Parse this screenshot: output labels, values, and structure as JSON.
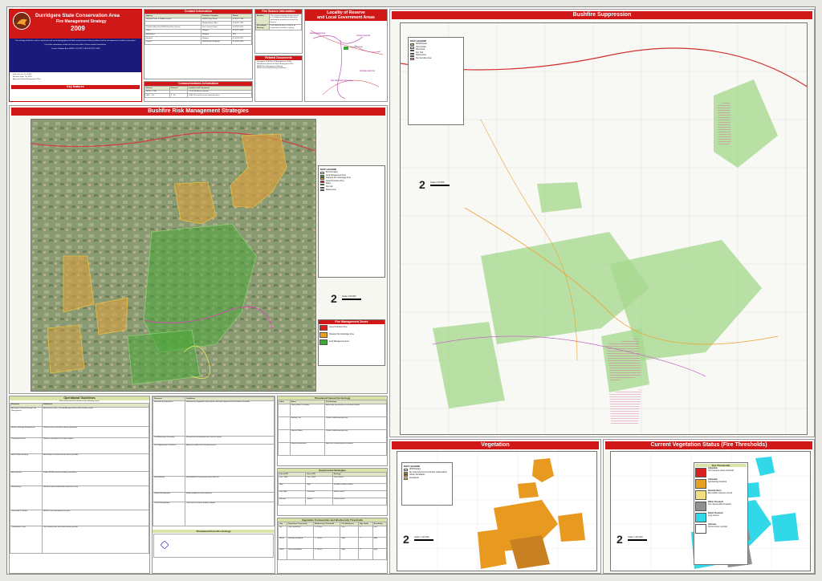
{
  "title": {
    "line1": "Durridgere State Conservation Area",
    "line2": "Fire Management Strategy",
    "year": "2009"
  },
  "intro": {
    "p1": "This strategy should be used in conjunction with aerial photography and field reconnaissance during incidents and the development of incident action plans.",
    "p2": "For further information contact the local area office. Phone number listed below.",
    "contact_line": "Contact: Mudgee Area NPWS T:02 6372 7199 F:02 6372 7850",
    "fields": [
      {
        "label": "Date of Issue:",
        "value": "Oct 2009"
      },
      {
        "label": "Revision Date:",
        "value": "Oct 2014"
      },
      {
        "label": "Approved Under Management Plan:",
        "value": ""
      }
    ],
    "legend_label": "Key features"
  },
  "contact": {
    "header": "Contact Information",
    "columns": [
      "Agency",
      "Position / Location",
      "Phone"
    ],
    "rows": [
      {
        "agency": "National Parks & Wildlife Service",
        "position": "NPWS Duty Officer",
        "phone": "02 6372 7199"
      },
      {
        "agency": "",
        "position": "Mudgee Area Office",
        "phone": "02 6372 7199"
      },
      {
        "agency": "Coolah Valley Zone NSW Rural Fire Service",
        "position": "Fire Control Centre",
        "phone": "02 6370 1100"
      },
      {
        "agency": "Police",
        "position": "Mudgee",
        "phone": "02 6372 8599"
      },
      {
        "agency": "Ambulance",
        "position": "Mudgee",
        "phone": "000"
      },
      {
        "agency": "Hospital",
        "position": "Mudgee",
        "phone": "02 6378 6222"
      },
      {
        "agency": "Council",
        "position": "Mid-Western Regional",
        "phone": "02 6378 2850"
      }
    ]
  },
  "comms": {
    "header": "Communications Information",
    "columns": [
      "Service",
      "Channel",
      "Location and Comments"
    ],
    "rows": [
      {
        "service": "NPWS - VHF",
        "channel": "",
        "comments": "Ch 44 Mt Misery repeater"
      },
      {
        "service": "UHF - CB",
        "channel": "5 - 40",
        "comments": "UHF CB used for local communications"
      }
    ]
  },
  "fireseason": {
    "header": "Fire Season Information",
    "rows": [
      {
        "label": "Bushfire",
        "value": "The statutory bushfire danger period is 1 October to 31 March each year and may be varied by the Rural Fire Service."
      },
      {
        "label": "Prescribed Burning",
        "value": "Prescribed burning is likely to be conducted in autumn or spring."
      }
    ]
  },
  "related": {
    "header": "Related Documents",
    "items": [
      "Durridgere SCA Plan of Management (2009)",
      "Mid-Western Bush Fire Risk Management Plan",
      "NPWS Fire Management Manual",
      "NPWS Prescribed Burning Guidelines"
    ]
  },
  "locality": {
    "header1": "Locality of Reserve",
    "header2": "and Local Government Areas",
    "labels": [
      "WARRUMBUNGLE",
      "UPPER HUNTER",
      "Durridgere SCA",
      "MID-WESTERN REGIONAL",
      "MUSWELLBROOK"
    ]
  },
  "risk_map": {
    "header": "Bushfire Risk Management Strategies",
    "legend_title": "MAP LEGEND",
    "legend": [
      {
        "label": "SCA boundary",
        "color": "#ffffff"
      },
      {
        "label": "Land Management Zone",
        "color": "#3aa83a"
      },
      {
        "label": "Strategic Fire Advantage Zone",
        "color": "#e8a020"
      },
      {
        "label": "Asset Protection Zone",
        "color": "#d82020"
      },
      {
        "label": "Road",
        "color": "#e03030"
      },
      {
        "label": "Fire trail",
        "color": "#f0d040"
      },
      {
        "label": "Watercourse",
        "color": "#5090e0"
      }
    ],
    "scale": "Scale 1:50 000",
    "zones_header": "Fire Management Zones",
    "zones": [
      {
        "label": "Asset Protection Zone",
        "color": "#d82020"
      },
      {
        "label": "Strategic Fire Advantage Zone",
        "color": "#e8a020"
      },
      {
        "label": "Land Management Zone",
        "color": "#3aa83a"
      }
    ]
  },
  "suppression": {
    "header": "Bushfire Suppression",
    "legend_title": "MAP LEGEND",
    "legend": [
      {
        "label": "NPWS Estate",
        "color": "#a8d890"
      },
      {
        "label": "Other Estate",
        "color": "#ffffff"
      },
      {
        "label": "Main Road",
        "color": "#e03030"
      },
      {
        "label": "Fire Trail",
        "color": "#f0a030"
      },
      {
        "label": "Watercourse",
        "color": "#5090e0"
      },
      {
        "label": "Fire Sensitive Area",
        "color": "#e0a0c0"
      }
    ],
    "scale": "Scale 1:50 000"
  },
  "guidelines": {
    "header": "Operational Guidelines",
    "subheader": "Brief all personnel in relation to the following issues",
    "columns": [
      "Resource",
      "Guidelines"
    ],
    "rows": [
      {
        "resource": "Aboriginal Cultural Heritage Site Management",
        "text": "Avoid known sites. Consult Aboriginal Sites Officer before works."
      },
      {
        "resource": "Historic Heritage Management",
        "text": "Protect historic structures during operations."
      },
      {
        "resource": "Threatened Fauna",
        "text": "Minimise disturbance to known habitat."
      },
      {
        "resource": "Aerial Water Bombing",
        "text": "Avoid drops on watercourses where possible."
      },
      {
        "resource": "Aerial Ignition",
        "text": "Follow NPWS aerial incendiary procedures."
      },
      {
        "resource": "Backburning",
        "text": "Backburn from established control lines only."
      },
      {
        "resource": "Command & Control",
        "text": "NPWS is the lead agency on park."
      },
      {
        "resource": "Containment Lines",
        "text": "Use existing trails and roads where possible."
      }
    ],
    "col2_rows": [
      {
        "resource": "Earthmoving Equipment",
        "text": "Earthmoving equipment may only be used with approval of the Incident Controller."
      },
      {
        "resource": "Fire Advantage Recording",
        "text": "Record new containment lines and fire extent."
      },
      {
        "resource": "Fire Suppression Chemicals",
        "text": "Avoid use within 50 m of watercourses."
      },
      {
        "resource": "Rehabilitation",
        "text": "Rehabilitate all containment lines after fire."
      },
      {
        "resource": "Smoke Management",
        "text": "Notify neighbours and authorities."
      },
      {
        "resource": "Visitor Management",
        "text": "Close park to visitors during incidents."
      }
    ]
  },
  "flora": {
    "header": "Threatened Fauna Fire Ecology",
    "columns": [
      "Label",
      "Name",
      "Fire Ecology"
    ],
    "rows": [
      {
        "label": "",
        "name": "Glossy Black-Cockatoo",
        "ecology": "Avoid high intensity fire in casuarina stands."
      },
      {
        "label": "",
        "name": "Barking Owl",
        "ecology": "Protect hollow-bearing trees."
      },
      {
        "label": "",
        "name": "Squirrel Glider",
        "ecology": "Protect hollow-bearing trees."
      },
      {
        "label": "",
        "name": "Regent Honeyeater",
        "ecology": "Avoid fire in flowering box-ironbark."
      }
    ],
    "header2": "Threatened Flora Fire Ecology"
  },
  "suppress_strategies": {
    "header": "Suppression Strategies",
    "columns": [
      "Forest FDI",
      "Grass FDI",
      "Strategy"
    ],
    "rows": [
      {
        "f": "Low - Mod",
        "g": "Low - Mod",
        "s": "Direct attack"
      },
      {
        "f": "High",
        "g": "High",
        "s": "Parallel or indirect attack"
      },
      {
        "f": "Very High",
        "g": "Very High",
        "s": "Indirect attack"
      },
      {
        "f": "Extreme",
        "g": "Severe",
        "s": "Protect assets"
      }
    ]
  },
  "veg_thresh": {
    "header": "Vegetation Communities and Biodiversity Thresholds",
    "columns": [
      "Veg.",
      "Vegetation Community",
      "Biodiversity Threshold",
      "Fire Behaviour",
      "Age Guide",
      "Sensitivity"
    ],
    "rows": [
      {
        "v": "Dry",
        "c": "Open woodland",
        "t": "5 - 30 yrs",
        "b": "Low",
        "a": "5",
        "s": "Low"
      },
      {
        "v": "Shrub",
        "c": "Shrubby woodland",
        "t": "7 - 30 yrs",
        "b": "Mod",
        "a": "7",
        "s": "Mod"
      },
      {
        "v": "Grass",
        "c": "Grassy woodland",
        "t": "5 - 40 yrs",
        "b": "High",
        "a": "5",
        "s": "High"
      }
    ]
  },
  "vegetation": {
    "header": "Vegetation",
    "legend_title": "MAP LEGEND",
    "legend": [
      {
        "label": "NPWS Estate",
        "color": "#ffffff"
      },
      {
        "label": "Dry Sclerophyll Forest (shrubby subformation)",
        "color": "#e89a20"
      },
      {
        "label": "Grassy Woodlands",
        "color": "#c88020"
      },
      {
        "label": "Grasslands",
        "color": "#f0d060"
      }
    ],
    "scale": "Scale 1:110 000"
  },
  "thresholds": {
    "header": "Current Vegetation Status (Fire Thresholds)",
    "legend_title": "Fire Thresholds",
    "legend": [
      {
        "label": "Vulnerable",
        "color": "#d82020",
        "desc": "Fire frequency above threshold."
      },
      {
        "label": "Vulnerable",
        "color": "#e8a020",
        "desc": "Approaching threshold."
      },
      {
        "label": "Recently Burnt",
        "color": "#f0e080",
        "desc": "Burnt within minimum interval."
      },
      {
        "label": "Within Threshold",
        "color": "#909090",
        "desc": "Fire interval within threshold."
      },
      {
        "label": "Below Threshold",
        "color": "#30d8e8",
        "desc": "Long unburnt."
      },
      {
        "label": "Unknown",
        "color": "#ffffff",
        "desc": "No fire history recorded."
      }
    ],
    "scale": "Scale 1:110 000"
  }
}
